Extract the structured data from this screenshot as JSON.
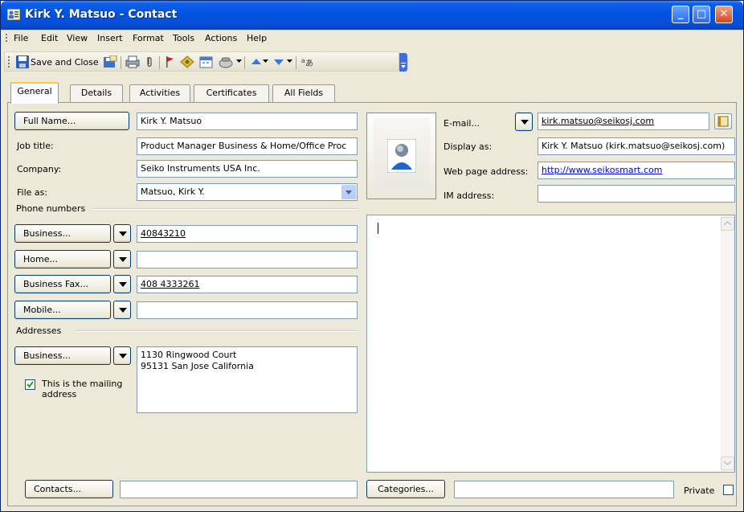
{
  "window": {
    "title": "Kirk Y. Matsuo - Contact",
    "controls": {
      "minimize": "_",
      "maximize": "□",
      "close": "✕"
    }
  },
  "menu": {
    "items": [
      {
        "label": "File"
      },
      {
        "label": "Edit"
      },
      {
        "label": "View"
      },
      {
        "label": "Insert"
      },
      {
        "label": "Format"
      },
      {
        "label": "Tools"
      },
      {
        "label": "Actions"
      },
      {
        "label": "Help"
      }
    ]
  },
  "toolbar": {
    "save_and_close_label": "Save and Close",
    "icons": [
      "save-icon",
      "save-copy-icon",
      "print-icon",
      "attach-icon",
      "flag-icon",
      "categorize-icon",
      "calendar-icon",
      "call-icon",
      "previous-item-icon",
      "next-item-icon",
      "encoding-icon",
      "toolbar-options-icon"
    ]
  },
  "tabs": [
    {
      "label": "General",
      "active": true
    },
    {
      "label": "Details",
      "active": false
    },
    {
      "label": "Activities",
      "active": false
    },
    {
      "label": "Certificates",
      "active": false
    },
    {
      "label": "All Fields",
      "active": false
    }
  ],
  "general": {
    "full_name_button": "Full Name...",
    "full_name_value": "Kirk Y. Matsuo",
    "job_title_label": "Job title:",
    "job_title_value": "Product Manager Business & Home/Office Proc",
    "company_label": "Company:",
    "company_value": "Seiko Instruments USA Inc.",
    "file_as_label": "File as:",
    "file_as_value": "Matsuo, Kirk Y.",
    "phone_numbers_label": "Phone numbers",
    "phones": [
      {
        "button": "Business...",
        "value": "40843210"
      },
      {
        "button": "Home...",
        "value": ""
      },
      {
        "button": "Business Fax...",
        "value": "408 4333261"
      },
      {
        "button": "Mobile...",
        "value": ""
      }
    ],
    "addresses_label": "Addresses",
    "address_button": "Business...",
    "address_lines": [
      "1130 Ringwood Court",
      "95131  San Jose  California"
    ],
    "mailing_checkbox_checked": true,
    "mailing_checkbox_label": "This is the mailing address",
    "email_button": "E-mail...",
    "email_value": "kirk.matsuo@seikosj.com",
    "display_as_label": "Display as:",
    "display_as_value": "Kirk Y. Matsuo (kirk.matsuo@seikosj.com)",
    "web_page_label": "Web page address:",
    "web_page_value": "http://www.seikosmart.com",
    "im_address_label": "IM address:",
    "im_address_value": "",
    "notes_value": "",
    "contacts_button": "Contacts...",
    "contacts_value": "",
    "categories_button": "Categories...",
    "categories_value": "",
    "private_label": "Private",
    "private_checked": false
  },
  "colors": {
    "titlebar": "#0053e1",
    "window_bg": "#ece9d8",
    "link": "#0000ff",
    "field_border": "#7f9db9"
  }
}
